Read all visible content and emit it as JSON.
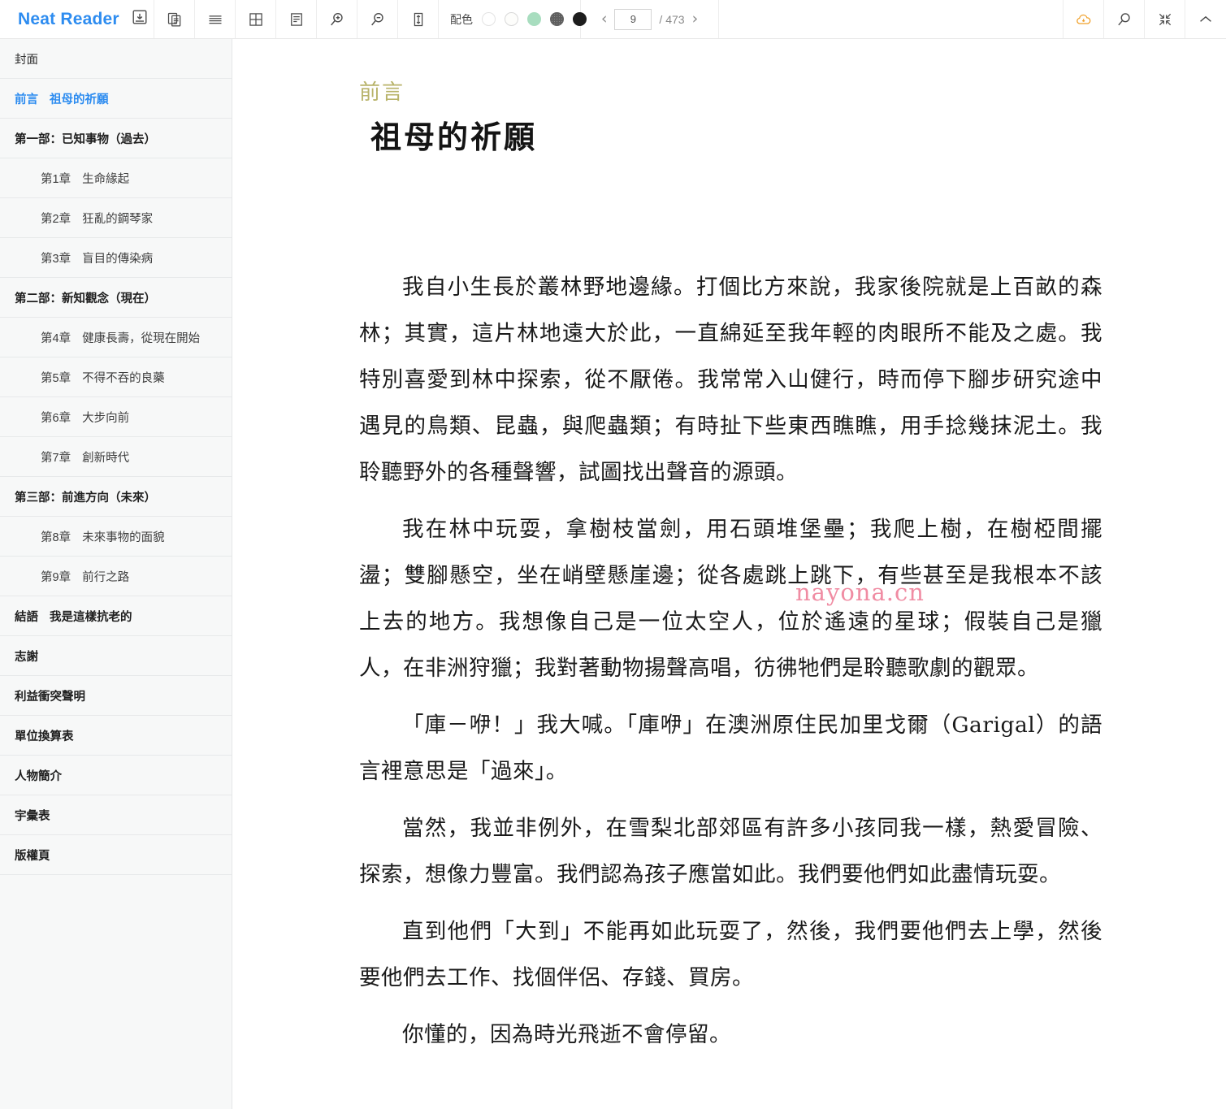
{
  "app": {
    "brand": "Neat Reader",
    "accent_color": "#2d8cf0"
  },
  "toolbar": {
    "icons": [
      {
        "name": "save-icon",
        "title": "Save"
      },
      {
        "name": "copy-pages-icon",
        "title": "Pages"
      },
      {
        "name": "list-lines-icon",
        "title": "Line spacing list"
      },
      {
        "name": "grid-icon",
        "title": "Grid layout"
      },
      {
        "name": "document-text-icon",
        "title": "Text layout"
      },
      {
        "name": "zoom-in-icon",
        "title": "Zoom in"
      },
      {
        "name": "zoom-out-icon",
        "title": "Zoom out"
      },
      {
        "name": "line-height-icon",
        "title": "Line height"
      }
    ],
    "color_scheme": {
      "label": "配色",
      "swatches": [
        {
          "name": "swatch-white",
          "hex": "#ffffff",
          "selected": true
        },
        {
          "name": "swatch-cream",
          "hex": "#fdfdfb",
          "selected": false
        },
        {
          "name": "swatch-green",
          "hex": "#a8ddbf",
          "selected": false
        },
        {
          "name": "swatch-gray",
          "hex": "#5f5f5f",
          "selected": false
        },
        {
          "name": "swatch-black",
          "hex": "#1d1d1d",
          "selected": false
        }
      ]
    },
    "pager": {
      "prev": "‹",
      "next": "›",
      "current_page": "9",
      "total_label": "/ 473",
      "total_pages": 473
    },
    "right_icons": [
      {
        "name": "cloud-sync-icon",
        "title": "Cloud sync",
        "color": "#f0a02a"
      },
      {
        "name": "search-icon",
        "title": "Search"
      },
      {
        "name": "compress-icon",
        "title": "Exit fullscreen"
      },
      {
        "name": "chevron-up-icon",
        "title": "Collapse toolbar"
      }
    ]
  },
  "sidebar": {
    "items": [
      {
        "label": "封面",
        "level": 0,
        "active": false,
        "part": false,
        "num": ""
      },
      {
        "label": "祖母的祈願",
        "level": 0,
        "active": true,
        "part": false,
        "num": "前言"
      },
      {
        "label": "第一部：已知事物（過去）",
        "level": 0,
        "active": false,
        "part": true,
        "num": ""
      },
      {
        "label": "生命緣起",
        "level": 1,
        "active": false,
        "part": false,
        "num": "第1章"
      },
      {
        "label": "狂亂的鋼琴家",
        "level": 1,
        "active": false,
        "part": false,
        "num": "第2章"
      },
      {
        "label": "盲目的傳染病",
        "level": 1,
        "active": false,
        "part": false,
        "num": "第3章"
      },
      {
        "label": "第二部：新知觀念（現在）",
        "level": 0,
        "active": false,
        "part": true,
        "num": ""
      },
      {
        "label": "健康長壽，從現在開始",
        "level": 1,
        "active": false,
        "part": false,
        "num": "第4章"
      },
      {
        "label": "不得不吞的良藥",
        "level": 1,
        "active": false,
        "part": false,
        "num": "第5章"
      },
      {
        "label": "大步向前",
        "level": 1,
        "active": false,
        "part": false,
        "num": "第6章"
      },
      {
        "label": "創新時代",
        "level": 1,
        "active": false,
        "part": false,
        "num": "第7章"
      },
      {
        "label": "第三部：前進方向（未來）",
        "level": 0,
        "active": false,
        "part": true,
        "num": ""
      },
      {
        "label": "未來事物的面貌",
        "level": 1,
        "active": false,
        "part": false,
        "num": "第8章"
      },
      {
        "label": "前行之路",
        "level": 1,
        "active": false,
        "part": false,
        "num": "第9章"
      },
      {
        "label": "我是這樣抗老的",
        "level": 0,
        "active": false,
        "part": true,
        "num": "結語"
      },
      {
        "label": "志謝",
        "level": 0,
        "active": false,
        "part": true,
        "num": ""
      },
      {
        "label": "利益衝突聲明",
        "level": 0,
        "active": false,
        "part": true,
        "num": ""
      },
      {
        "label": "單位換算表",
        "level": 0,
        "active": false,
        "part": true,
        "num": ""
      },
      {
        "label": "人物簡介",
        "level": 0,
        "active": false,
        "part": true,
        "num": ""
      },
      {
        "label": "宇彙表",
        "level": 0,
        "active": false,
        "part": true,
        "num": ""
      },
      {
        "label": "版權頁",
        "level": 0,
        "active": false,
        "part": true,
        "num": ""
      }
    ]
  },
  "content": {
    "eyebrow": "前言",
    "title": "祖母的祈願",
    "watermark": "nayona.cn",
    "paragraphs": [
      "我自小生長於叢林野地邊緣。打個比方來說，我家後院就是上百畝的森林；其實，這片林地遠大於此，一直綿延至我年輕的肉眼所不能及之處。我特別喜愛到林中探索，從不厭倦。我常常入山健行，時而停下腳步研究途中遇見的鳥類、昆蟲，與爬蟲類；有時扯下些東西瞧瞧，用手捻幾抹泥土。我聆聽野外的各種聲響，試圖找出聲音的源頭。",
      "我在林中玩耍，拿樹枝當劍，用石頭堆堡壘；我爬上樹，在樹椏間擺盪；雙腳懸空，坐在峭壁懸崖邊；從各處跳上跳下，有些甚至是我根本不該上去的地方。我想像自己是一位太空人，位於遙遠的星球；假裝自己是獵人，在非洲狩獵；我對著動物揚聲高唱，彷彿牠們是聆聽歌劇的觀眾。",
      "「庫－咿！」我大喊。「庫咿」在澳洲原住民加里戈爾（Garigal）的語言裡意思是「過來」。",
      "當然，我並非例外，在雪梨北部郊區有許多小孩同我一樣，熱愛冒險、探索，想像力豐富。我們認為孩子應當如此。我們要他們如此盡情玩耍。",
      "直到他們「大到」不能再如此玩耍了，然後，我們要他們去上學，然後要他們去工作、找個伴侶、存錢、買房。",
      "你懂的，因為時光飛逝不會停留。"
    ]
  }
}
